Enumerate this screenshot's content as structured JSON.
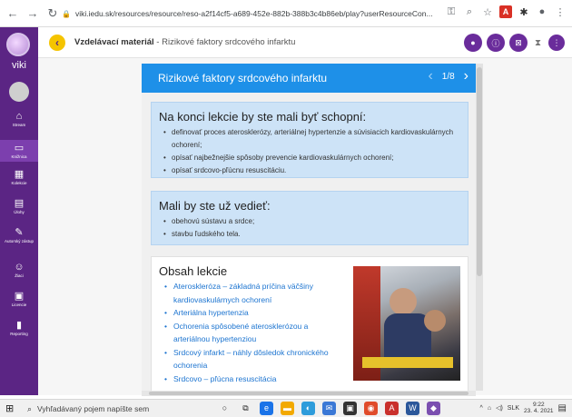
{
  "browser": {
    "url": "viki.iedu.sk/resources/resource/reso-a2f14cf5-a689-452e-882b-388b3c4b86eb/play?userResourceCon..."
  },
  "app": {
    "name": "viki",
    "accent": "#5b2584",
    "sidebar": [
      {
        "label": "Stream",
        "icon": "home-icon"
      },
      {
        "label": "Knižnica",
        "icon": "library-icon"
      },
      {
        "label": "Kolekcie",
        "icon": "collections-icon"
      },
      {
        "label": "Úlohy",
        "icon": "tasks-icon"
      },
      {
        "label": "Autorský zástup",
        "icon": "author-icon"
      },
      {
        "label": "Žiaci",
        "icon": "students-icon"
      },
      {
        "label": "Licencie",
        "icon": "license-icon"
      },
      {
        "label": "Reporting",
        "icon": "reporting-icon"
      }
    ],
    "title_bold": "Vzdelávací materiál",
    "title_rest": " - Rizikové faktory srdcového infarktu"
  },
  "lesson": {
    "header": "Rizikové faktory srdcového infarktu",
    "pager": "1/8",
    "header_color": "#1e90e8",
    "goals_title": "Na konci lekcie by ste mali byť schopní:",
    "goals": [
      "definovať proces aterosklerózy, arteriálnej hypertenzie a súvisiacich kardiovaskulárnych ochorení;",
      "opísať najbežnejšie spôsoby prevencie kardiovaskulárnych ochorení;",
      "opísať srdcovo-pľúcnu resuscitáciu."
    ],
    "prereq_title": "Mali by ste už vedieť:",
    "prereq": [
      "obehovú sústavu a srdce;",
      "stavbu ľudského tela."
    ],
    "contents_title": "Obsah lekcie",
    "contents": [
      "Ateroskleróza – základná príčina väčšiny kardiovaskulárnych ochorení",
      "Arteriálna hypertenzia",
      "Ochorenia spôsobené aterosklerózou a arteriálnou hypertenziou",
      "Srdcový infarkt – náhly dôsledok chronického ochorenia",
      "Srdcovo – pľúcna resuscitácia"
    ]
  },
  "taskbar": {
    "search_placeholder": "Vyhľadávaný pojem napíšte sem",
    "lang": "SLK",
    "time": "9:22",
    "date": "23. 4. 2021"
  }
}
